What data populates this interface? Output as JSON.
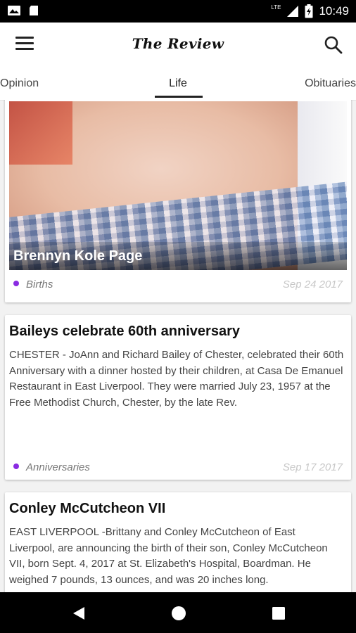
{
  "status_bar": {
    "time": "10:49",
    "network": "LTE"
  },
  "app_bar": {
    "brand": "The Review"
  },
  "tabs": [
    "Opinion",
    "Life",
    "Obituaries"
  ],
  "active_tab": "Life",
  "accent_color": "#8a2be2",
  "articles": [
    {
      "photo_caption": "Brennyn Kole Page",
      "category": "Births",
      "date": "Sep 24 2017"
    },
    {
      "title": "Baileys celebrate 60th anniversary",
      "body": "CHESTER - JoAnn and Richard Bailey of Chester, celebrated their 60th Anniversary with a dinner hosted by their children, at Casa De Emanuel Restaurant in East Liverpool. They were married July 23, 1957 at the Free Methodist Church, Chester, by the late Rev.",
      "category": "Anniversaries",
      "date": "Sep 17 2017"
    },
    {
      "title": "Conley McCutcheon VII",
      "body": "EAST LIVERPOOL -Brittany and Conley McCutcheon of East Liverpool, are announcing the birth of their son, Conley McCutcheon VII, born Sept. 4, 2017 at St. Elizabeth's Hospital, Boardman. He weighed 7 pounds, 13 ounces, and was 20 inches long."
    }
  ]
}
